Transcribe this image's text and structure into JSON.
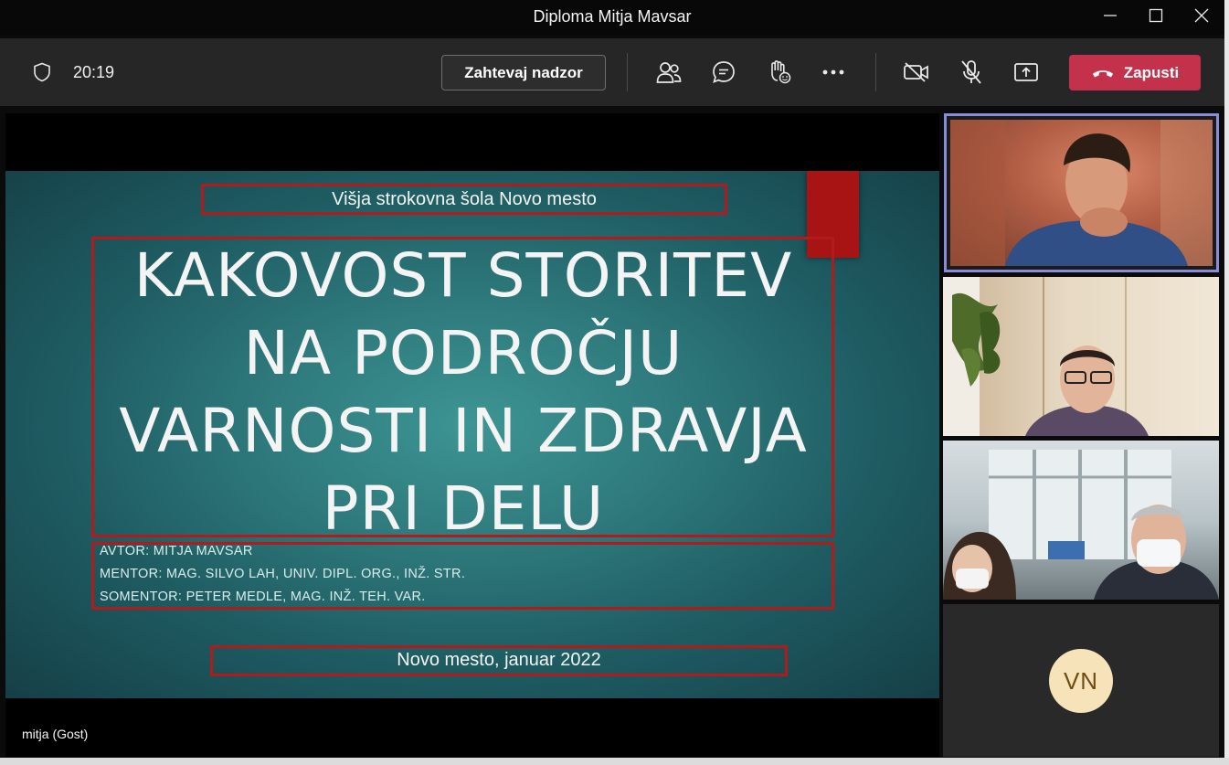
{
  "window": {
    "title": "Diploma Mitja Mavsar",
    "controls": [
      "minimize-icon",
      "maximize-icon",
      "close-icon"
    ]
  },
  "toolbar": {
    "timer": "20:19",
    "request_control_label": "Zahtevaj nadzor",
    "leave_label": "Zapusti",
    "icons": [
      "shield-icon",
      "participants-icon",
      "chat-icon",
      "raise-hand-icon",
      "more-icon",
      "camera-off-icon",
      "mic-off-icon",
      "share-icon",
      "phone-icon"
    ],
    "colors": {
      "leave": "#c4314b",
      "toolbar_bg": "#262626"
    }
  },
  "slide": {
    "school": "Višja strokovna šola Novo mesto",
    "title_lines": [
      "KAKOVOST STORITEV",
      "NA PODROČJU",
      "VARNOSTI IN ZDRAVJA",
      "PRI DELU"
    ],
    "credits": [
      "AVTOR: MITJA MAVSAR",
      "MENTOR: MAG. SILVO LAH, UNIV. DIPL. ORG., INŽ. STR.",
      "SOMENTOR: PETER MEDLE, MAG. INŽ. TEH. VAR."
    ],
    "date_line": "Novo mesto, januar 2022",
    "colors": {
      "accent_red": "#b21b1b",
      "teal": "#2f7b7d"
    }
  },
  "presenter": {
    "name": "mitja (Gost)"
  },
  "participants": {
    "avatar_initials": "VN",
    "avatar_color": "#f6e3b9",
    "active_speaker_border": "#8b8cd8"
  }
}
